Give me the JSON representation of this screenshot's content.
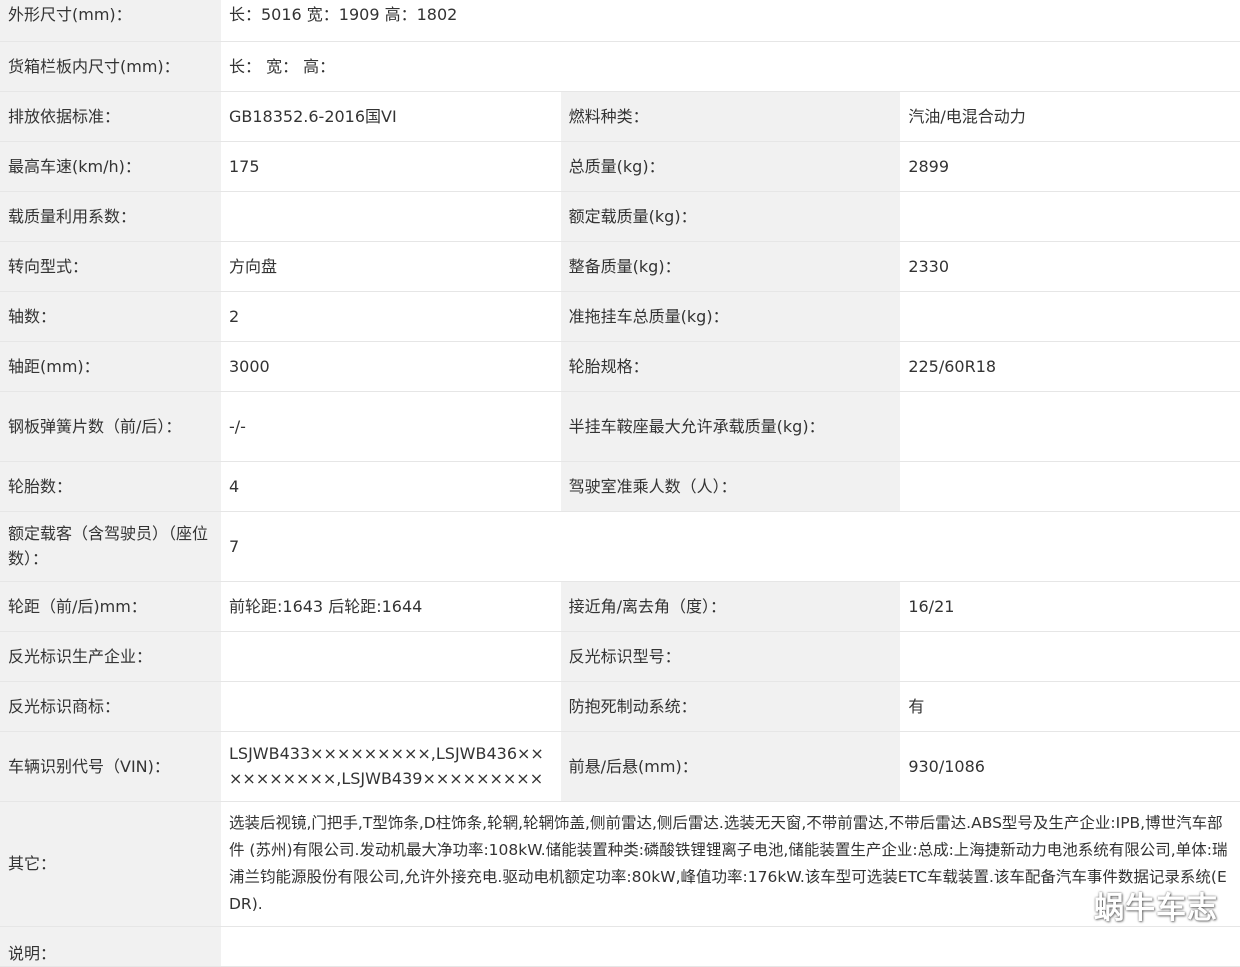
{
  "rows": [
    {
      "l1": "外形尺寸(mm)：",
      "v1": "长：5016 宽：1909 高：1802"
    },
    {
      "l1": "货箱栏板内尺寸(mm)：",
      "v1": "长：  宽：  高："
    },
    {
      "l1": "排放依据标准：",
      "v1": "GB18352.6-2016国VI",
      "l2": "燃料种类：",
      "v2": "汽油/电混合动力"
    },
    {
      "l1": "最高车速(km/h)：",
      "v1": "175",
      "l2": "总质量(kg)：",
      "v2": "2899"
    },
    {
      "l1": "载质量利用系数：",
      "v1": "",
      "l2": "额定载质量(kg)：",
      "v2": ""
    },
    {
      "l1": "转向型式：",
      "v1": "方向盘",
      "l2": "整备质量(kg)：",
      "v2": "2330"
    },
    {
      "l1": "轴数：",
      "v1": "2",
      "l2": "准拖挂车总质量(kg)：",
      "v2": ""
    },
    {
      "l1": "轴距(mm)：",
      "v1": "3000",
      "l2": "轮胎规格：",
      "v2": "225/60R18"
    },
    {
      "l1": "钢板弹簧片数（前/后）：",
      "v1": "-/-",
      "l2": "半挂车鞍座最大允许承载质量(kg)：",
      "v2": ""
    },
    {
      "l1": "轮胎数：",
      "v1": "4",
      "l2": "驾驶室准乘人数（人）：",
      "v2": ""
    },
    {
      "l1": "额定载客（含驾驶员）（座位数）：",
      "v1": "7"
    },
    {
      "l1": "轮距（前/后)mm：",
      "v1": "前轮距:1643 后轮距:1644",
      "l2": "接近角/离去角（度）：",
      "v2": "16/21"
    },
    {
      "l1": "反光标识生产企业：",
      "v1": "",
      "l2": "反光标识型号：",
      "v2": ""
    },
    {
      "l1": "反光标识商标：",
      "v1": "",
      "l2": "防抱死制动系统：",
      "v2": "有"
    },
    {
      "l1": "车辆识别代号（VIN)：",
      "v1": "LSJWB433×××××××××,LSJWB436××××××××××,LSJWB439×××××××××",
      "l2": "前悬/后悬(mm)：",
      "v2": "930/1086"
    },
    {
      "l1": "其它：",
      "v1": "选装后视镜,门把手,T型饰条,D柱饰条,轮辋,轮辋饰盖,侧前雷达,侧后雷达.选装无天窗,不带前雷达,不带后雷达.ABS型号及生产企业:IPB,博世汽车部件 (苏州)有限公司.发动机最大净功率:108kW.储能装置种类:磷酸铁锂锂离子电池,储能装置生产企业:总成:上海捷新动力电池系统有限公司,单体:瑞浦兰钧能源股份有限公司,允许外接充电.驱动电机额定功率:80kW,峰值功率:176kW.该车型可选装ETC车载装置.该车配备汽车事件数据记录系统(EDR)."
    },
    {
      "l1": "说明：",
      "v1": ""
    }
  ],
  "watermark": "蜗牛车志"
}
